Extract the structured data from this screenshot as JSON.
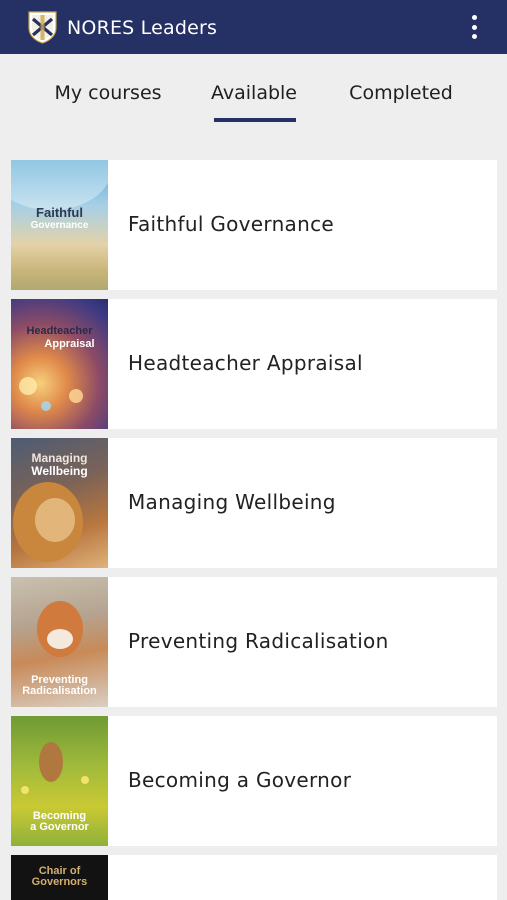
{
  "app": {
    "title": "NORES Leaders"
  },
  "tabs": [
    {
      "label": "My courses"
    },
    {
      "label": "Available"
    },
    {
      "label": "Completed"
    }
  ],
  "courses": [
    {
      "title": "Faithful Governance",
      "thumb_line1": "Faithful",
      "thumb_line2": "Governance"
    },
    {
      "title": "Headteacher Appraisal",
      "thumb_line1": "Headteacher",
      "thumb_line2": "Appraisal"
    },
    {
      "title": "Managing Wellbeing",
      "thumb_line1": "Managing",
      "thumb_line2": "Wellbeing"
    },
    {
      "title": "Preventing Radicalisation",
      "thumb_line1": "Preventing",
      "thumb_line2": "Radicalisation"
    },
    {
      "title": "Becoming a Governor",
      "thumb_line1": "Becoming",
      "thumb_line2": "a Governor"
    },
    {
      "title": "",
      "thumb_line1": "Chair of",
      "thumb_line2": "Governors"
    }
  ],
  "colors": {
    "primary": "#253064",
    "background": "#eeeeee",
    "card": "#ffffff"
  },
  "icons": {
    "logo": "shield-logo-icon",
    "menu": "more-vert-icon"
  }
}
